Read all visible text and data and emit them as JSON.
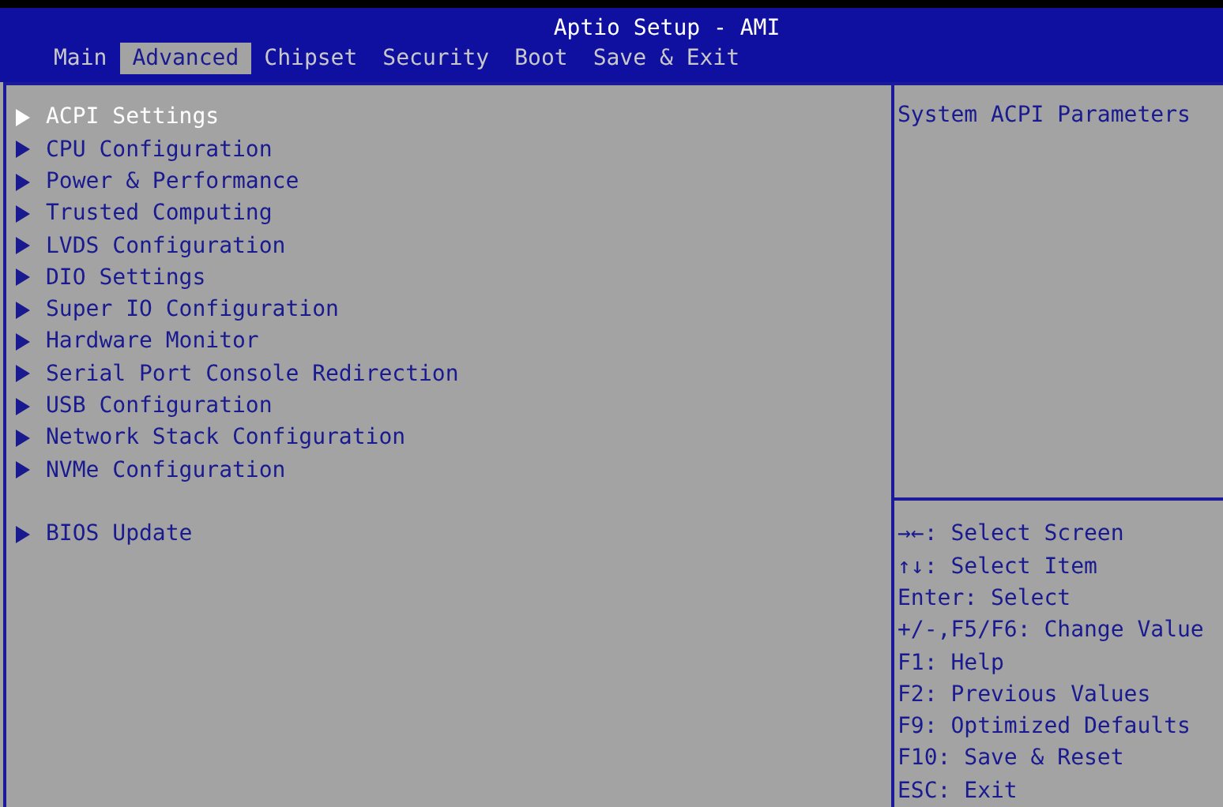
{
  "window": {
    "title": "Aptio Setup - AMI"
  },
  "tabs": [
    {
      "label": "Main",
      "selected": false
    },
    {
      "label": "Advanced",
      "selected": true
    },
    {
      "label": "Chipset",
      "selected": false
    },
    {
      "label": "Security",
      "selected": false
    },
    {
      "label": "Boot",
      "selected": false
    },
    {
      "label": "Save & Exit",
      "selected": false
    }
  ],
  "menu_groups": [
    {
      "items": [
        {
          "label": "ACPI Settings",
          "selected": true
        },
        {
          "label": "CPU Configuration",
          "selected": false
        },
        {
          "label": "Power & Performance",
          "selected": false
        },
        {
          "label": "Trusted Computing",
          "selected": false
        },
        {
          "label": "LVDS Configuration",
          "selected": false
        },
        {
          "label": "DIO Settings",
          "selected": false
        },
        {
          "label": "Super IO Configuration",
          "selected": false
        },
        {
          "label": "Hardware Monitor",
          "selected": false
        },
        {
          "label": "Serial Port Console Redirection",
          "selected": false
        },
        {
          "label": "USB Configuration",
          "selected": false
        },
        {
          "label": "Network Stack Configuration",
          "selected": false
        },
        {
          "label": "NVMe Configuration",
          "selected": false
        }
      ]
    },
    {
      "items": [
        {
          "label": "BIOS Update",
          "selected": false
        }
      ]
    }
  ],
  "help_text": "System ACPI Parameters",
  "key_hints": [
    "→←: Select Screen",
    "↑↓: Select Item",
    "Enter: Select",
    "+/-,F5/F6: Change Value",
    "F1: Help",
    "F2: Previous Values",
    "F9: Optimized Defaults",
    "F10: Save & Reset",
    "ESC: Exit"
  ]
}
